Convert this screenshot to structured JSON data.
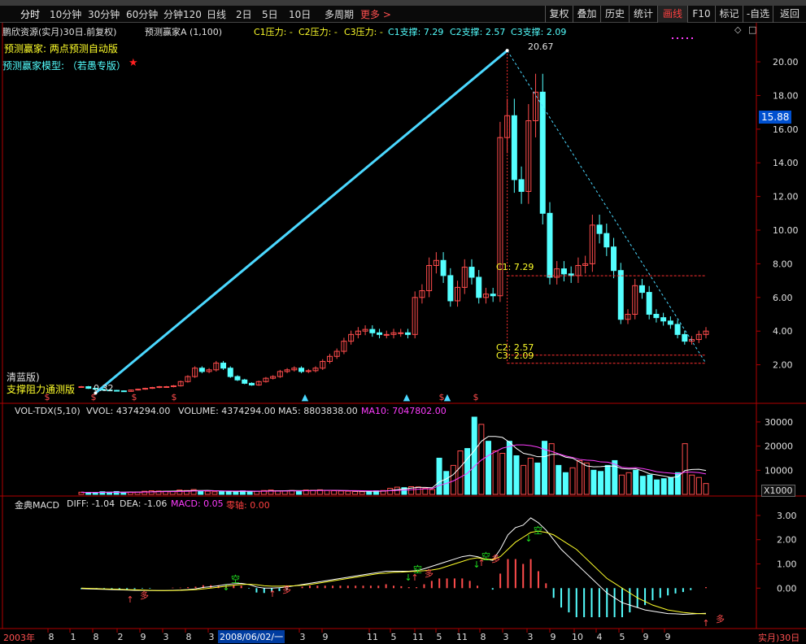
{
  "toolbar": {
    "tabs": [
      "分时",
      "10分钟",
      "30分钟",
      "60分钟",
      "分钟120",
      "日线",
      "2日",
      "5日",
      "10日",
      "多周期",
      "更多 >"
    ],
    "buttons": [
      "复权",
      "叠加",
      "历史",
      "统计",
      "画线",
      "F10",
      "标记",
      "-自选",
      "返回"
    ],
    "active_button": "画线"
  },
  "header": {
    "stock": "鹏欣资源(实月)30日.前复权)",
    "indicator": "预测赢家A (1,100)",
    "c1p": "C1压力: -",
    "c2p": "C2压力: -",
    "c3p": "C3压力: -",
    "c1s": "C1支撑: 7.29",
    "c2s": "C2支撑: 2.57",
    "c3s": "C3支撑: 2.09",
    "line1": "预测赢家: 两点预测自动版",
    "line2": "预测赢家模型: （若愚专版）",
    "star": "★"
  },
  "labels": {
    "peak": "20.67",
    "low": "0.32",
    "c1": "C1: 7.29",
    "c2": "C2: 2.57",
    "c3": "C3: 2.09",
    "left1": "清蓝版)",
    "left2": "支撑阻力通测版",
    "price_box": "15.88",
    "vol_unit": "X1000"
  },
  "vol_header": {
    "name": "VOL-TDX(5,10)",
    "vvol": "VVOL: 4374294.00",
    "volume": "VOLUME: 4374294.00",
    "ma5": "MA5: 8803838.00",
    "ma10": "MA10: 7047802.00"
  },
  "macd_header": {
    "name": "金典MACD",
    "diff": "DIFF: -1.04",
    "dea": "DEA: -1.06",
    "macd": "MACD: 0.05",
    "zero": "零轴: 0.00"
  },
  "markers": {
    "empty": "空",
    "many": "多"
  },
  "x_axis": {
    "year": "2003年",
    "date": "2008/06/02/一",
    "right": "实月)30日",
    "ticks": [
      "8",
      "1",
      "8",
      "2",
      "9",
      "3",
      "8",
      "3",
      "3",
      "9",
      "11",
      "5",
      "11",
      "5",
      "11",
      "8",
      "3",
      "3",
      "9",
      "10",
      "4",
      "5",
      "9",
      "9"
    ]
  },
  "colors": {
    "up": "#ff4c4c",
    "down": "#54ffff",
    "trend": "#4bd8ff",
    "yellow": "#ffff2a",
    "magenta": "#ff3cff",
    "grid": "#7a0000",
    "axis": "#b00000"
  },
  "chart_data": [
    {
      "type": "candlestick",
      "title": "鹏欣资源 30日",
      "ylim": [
        0,
        21.5
      ],
      "yticks": [
        2,
        4,
        6,
        8,
        10,
        12,
        14,
        16,
        18,
        20
      ],
      "values": [
        0.7,
        0.6,
        0.55,
        0.5,
        0.48,
        0.45,
        0.42,
        0.5,
        0.55,
        0.6,
        0.65,
        0.7,
        0.7,
        0.75,
        1.0,
        1.3,
        1.8,
        1.6,
        1.7,
        2.1,
        1.8,
        1.3,
        1.1,
        0.9,
        0.8,
        1.0,
        1.2,
        1.3,
        1.6,
        1.7,
        1.8,
        1.6,
        1.65,
        1.8,
        2.2,
        2.5,
        2.8,
        3.4,
        3.8,
        4.0,
        4.1,
        3.9,
        3.8,
        3.8,
        3.9,
        3.9,
        3.8,
        6.0,
        6.4,
        7.9,
        8.2,
        7.3,
        5.8,
        6.6,
        7.8,
        7.2,
        6.0,
        6.2,
        6.1,
        15.5,
        16.8,
        13.0,
        12.3,
        16.5,
        18.2,
        11.0,
        7.2,
        7.7,
        7.4,
        7.3,
        7.9,
        8.0,
        10.3,
        9.8,
        9.0,
        7.6,
        4.7,
        5.0,
        6.7,
        6.3,
        5.0,
        4.8,
        4.6,
        4.4,
        3.8,
        3.4,
        3.5,
        3.8,
        4.0
      ],
      "peak": 20.67,
      "low": 0.32,
      "support_lines": [
        7.29,
        2.57,
        2.09
      ],
      "trendline": [
        {
          "x": 0.32,
          "y": 0.32
        },
        {
          "x": 20.67,
          "y": 20.67
        },
        {
          "x": 2.09,
          "y": 2.09
        }
      ]
    },
    {
      "type": "bar",
      "title": "VOL-TDX(5,10)",
      "ylim": [
        0,
        33000
      ],
      "yticks": [
        10000,
        20000,
        30000
      ],
      "values": [
        900,
        700,
        800,
        1100,
        900,
        1200,
        700,
        900,
        1000,
        1300,
        1500,
        1400,
        1300,
        1200,
        1800,
        1600,
        2000,
        1500,
        1300,
        1100,
        1200,
        1300,
        1100,
        1500,
        1200,
        1300,
        1600,
        1800,
        1500,
        1400,
        1600,
        1500,
        1800,
        1700,
        1900,
        1600,
        1500,
        1400,
        1300,
        1200,
        1100,
        1300,
        1500,
        1600,
        2500,
        3000,
        2800,
        3200,
        3100,
        2500,
        2000,
        15000,
        9500,
        12000,
        18000,
        19000,
        32000,
        29000,
        22000,
        18000,
        17000,
        22000,
        16000,
        12000,
        15000,
        13000,
        22000,
        21000,
        12000,
        9000,
        11000,
        14000,
        13000,
        10000,
        9500,
        12000,
        14000,
        8000,
        9000,
        10000,
        7500,
        8000,
        6000,
        6500,
        7000,
        9000,
        21000,
        8000,
        7000,
        4500
      ],
      "series": [
        {
          "name": "MA5",
          "values": [
            8803838
          ]
        },
        {
          "name": "MA10",
          "values": [
            7047802
          ]
        }
      ]
    },
    {
      "type": "line",
      "title": "金典MACD",
      "ylim": [
        -1.4,
        3.3
      ],
      "yticks": [
        0,
        1,
        2,
        3
      ],
      "series": [
        {
          "name": "DIFF",
          "values": [
            -0.02,
            -0.03,
            -0.04,
            -0.05,
            -0.06,
            -0.07,
            -0.08,
            -0.09,
            -0.09,
            -0.1,
            -0.1,
            -0.1,
            -0.09,
            -0.08,
            -0.06,
            -0.03,
            0.03,
            0.06,
            0.1,
            0.15,
            0.18,
            0.2,
            0.15,
            0.05,
            0.0,
            0.0,
            0.02,
            0.05,
            0.1,
            0.15,
            0.2,
            0.25,
            0.3,
            0.35,
            0.4,
            0.45,
            0.5,
            0.55,
            0.6,
            0.65,
            0.7,
            0.7,
            0.7,
            0.7,
            0.72,
            0.8,
            0.9,
            1.0,
            1.1,
            1.2,
            1.3,
            1.35,
            1.3,
            1.2,
            1.15,
            1.6,
            2.2,
            2.5,
            2.6,
            2.9,
            2.7,
            2.4,
            2.0,
            1.6,
            1.3,
            1.0,
            0.7,
            0.4,
            0.1,
            -0.2,
            -0.4,
            -0.6,
            -0.7,
            -0.8,
            -0.9,
            -0.95,
            -1.0,
            -1.05,
            -1.06,
            -1.08,
            -1.07,
            -1.05,
            -1.04
          ]
        },
        {
          "name": "DEA",
          "values": [
            0.0,
            -0.01,
            -0.02,
            -0.03,
            -0.04,
            -0.05,
            -0.06,
            -0.07,
            -0.08,
            -0.09,
            -0.1,
            -0.1,
            -0.1,
            -0.09,
            -0.08,
            -0.06,
            -0.03,
            0.0,
            0.04,
            0.08,
            0.12,
            0.15,
            0.16,
            0.14,
            0.1,
            0.08,
            0.08,
            0.09,
            0.1,
            0.12,
            0.15,
            0.2,
            0.25,
            0.3,
            0.35,
            0.4,
            0.45,
            0.5,
            0.55,
            0.6,
            0.62,
            0.65,
            0.66,
            0.68,
            0.7,
            0.72,
            0.75,
            0.8,
            0.9,
            1.0,
            1.1,
            1.2,
            1.25,
            1.2,
            1.18,
            1.3,
            1.6,
            1.9,
            2.1,
            2.3,
            2.35,
            2.3,
            2.2,
            2.0,
            1.8,
            1.6,
            1.3,
            1.0,
            0.7,
            0.4,
            0.2,
            0.0,
            -0.2,
            -0.4,
            -0.55,
            -0.7,
            -0.8,
            -0.9,
            -0.95,
            -1.0,
            -1.03,
            -1.05,
            -1.06
          ]
        }
      ],
      "macd_value": 0.05
    }
  ]
}
